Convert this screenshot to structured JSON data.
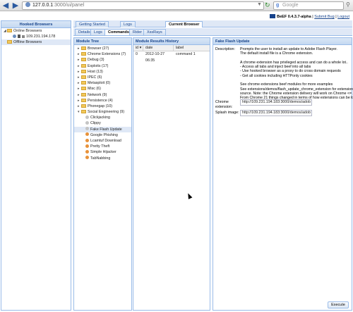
{
  "browser": {
    "url_host": "127.0.0.1",
    "url_path": ":3000/ui/panel",
    "search_engine": "Google",
    "search_placeholder": "Google"
  },
  "left_panel": {
    "title": "Hooked Browsers",
    "online_label": "Online Browsers",
    "online_ip": "109.231.194.178",
    "offline_label": "Offline Browsers"
  },
  "header": {
    "version": "BeEF  0.4.3.7-alpha",
    "submit_bug": "Submit  Bug",
    "logout": "Logout",
    "separator": "|"
  },
  "main_tabs": [
    "Getting Started",
    "Logs",
    "Current Browser"
  ],
  "sub_tabs": [
    "Details",
    "Logs",
    "Commands",
    "Rider",
    "XssRays"
  ],
  "module_tree": {
    "title": "Module Tree",
    "categories": [
      "Browser (27)",
      "Chrome Extensions (7)",
      "Debug (3)",
      "Exploits (17)",
      "Host (13)",
      "IPEC (6)",
      "Metasploit (0)",
      "Misc (6)",
      "Network (9)",
      "Persistence (4)",
      "Phonegap (10)",
      "Social Engineering (9)"
    ],
    "social_children": [
      {
        "label": "Clickjacking",
        "status": "grey"
      },
      {
        "label": "Clippy",
        "status": "grey"
      },
      {
        "label": "Fake Flash Update",
        "status": "grey"
      },
      {
        "label": "Google Phishing",
        "status": "orange"
      },
      {
        "label": "Lcamtuf Download",
        "status": "orange"
      },
      {
        "label": "Pretty Theft",
        "status": "orange"
      },
      {
        "label": "Simple Hijacker",
        "status": "orange"
      },
      {
        "label": "TabNabbing",
        "status": "orange"
      }
    ]
  },
  "history": {
    "title": "Module Results History",
    "headers": [
      "id",
      "date",
      "label"
    ],
    "rows": [
      {
        "id": "0",
        "date": "2012-10-27 06:35",
        "label": "command 1"
      }
    ]
  },
  "detail": {
    "title": "Fake Flash Update",
    "description_label": "Description:",
    "description_lines": [
      "Prompts the user to install an update to Adobe Flash Player.",
      "The default install file is a Chrome extension.",
      "",
      "A chrome extension has privileged access and can do a whole lot..",
      "- Access all tabs and inject beef into all tabs",
      "- Use hooked browser as a proxy to do cross domain requests",
      "- Get all cookies including HTTPonly cookies",
      "",
      "See chrome extensions beef modules for more examples",
      "See extensions/demos/flash_update_chrome_extension for extension",
      "source. Note: the Chrome extension delivery will work on Chrome <= 20.",
      "From Chrome 21 things changed in terms of how extensions can be loaded."
    ],
    "chrome_extension_label": "Chrome extension:",
    "chrome_extension_value": "http://109.231.194.183:3000/demos/adob",
    "splash_image_label": "Splash image:",
    "splash_image_value": "http://109.231.194.183:3000/demos/adob",
    "execute_label": "Execute"
  }
}
